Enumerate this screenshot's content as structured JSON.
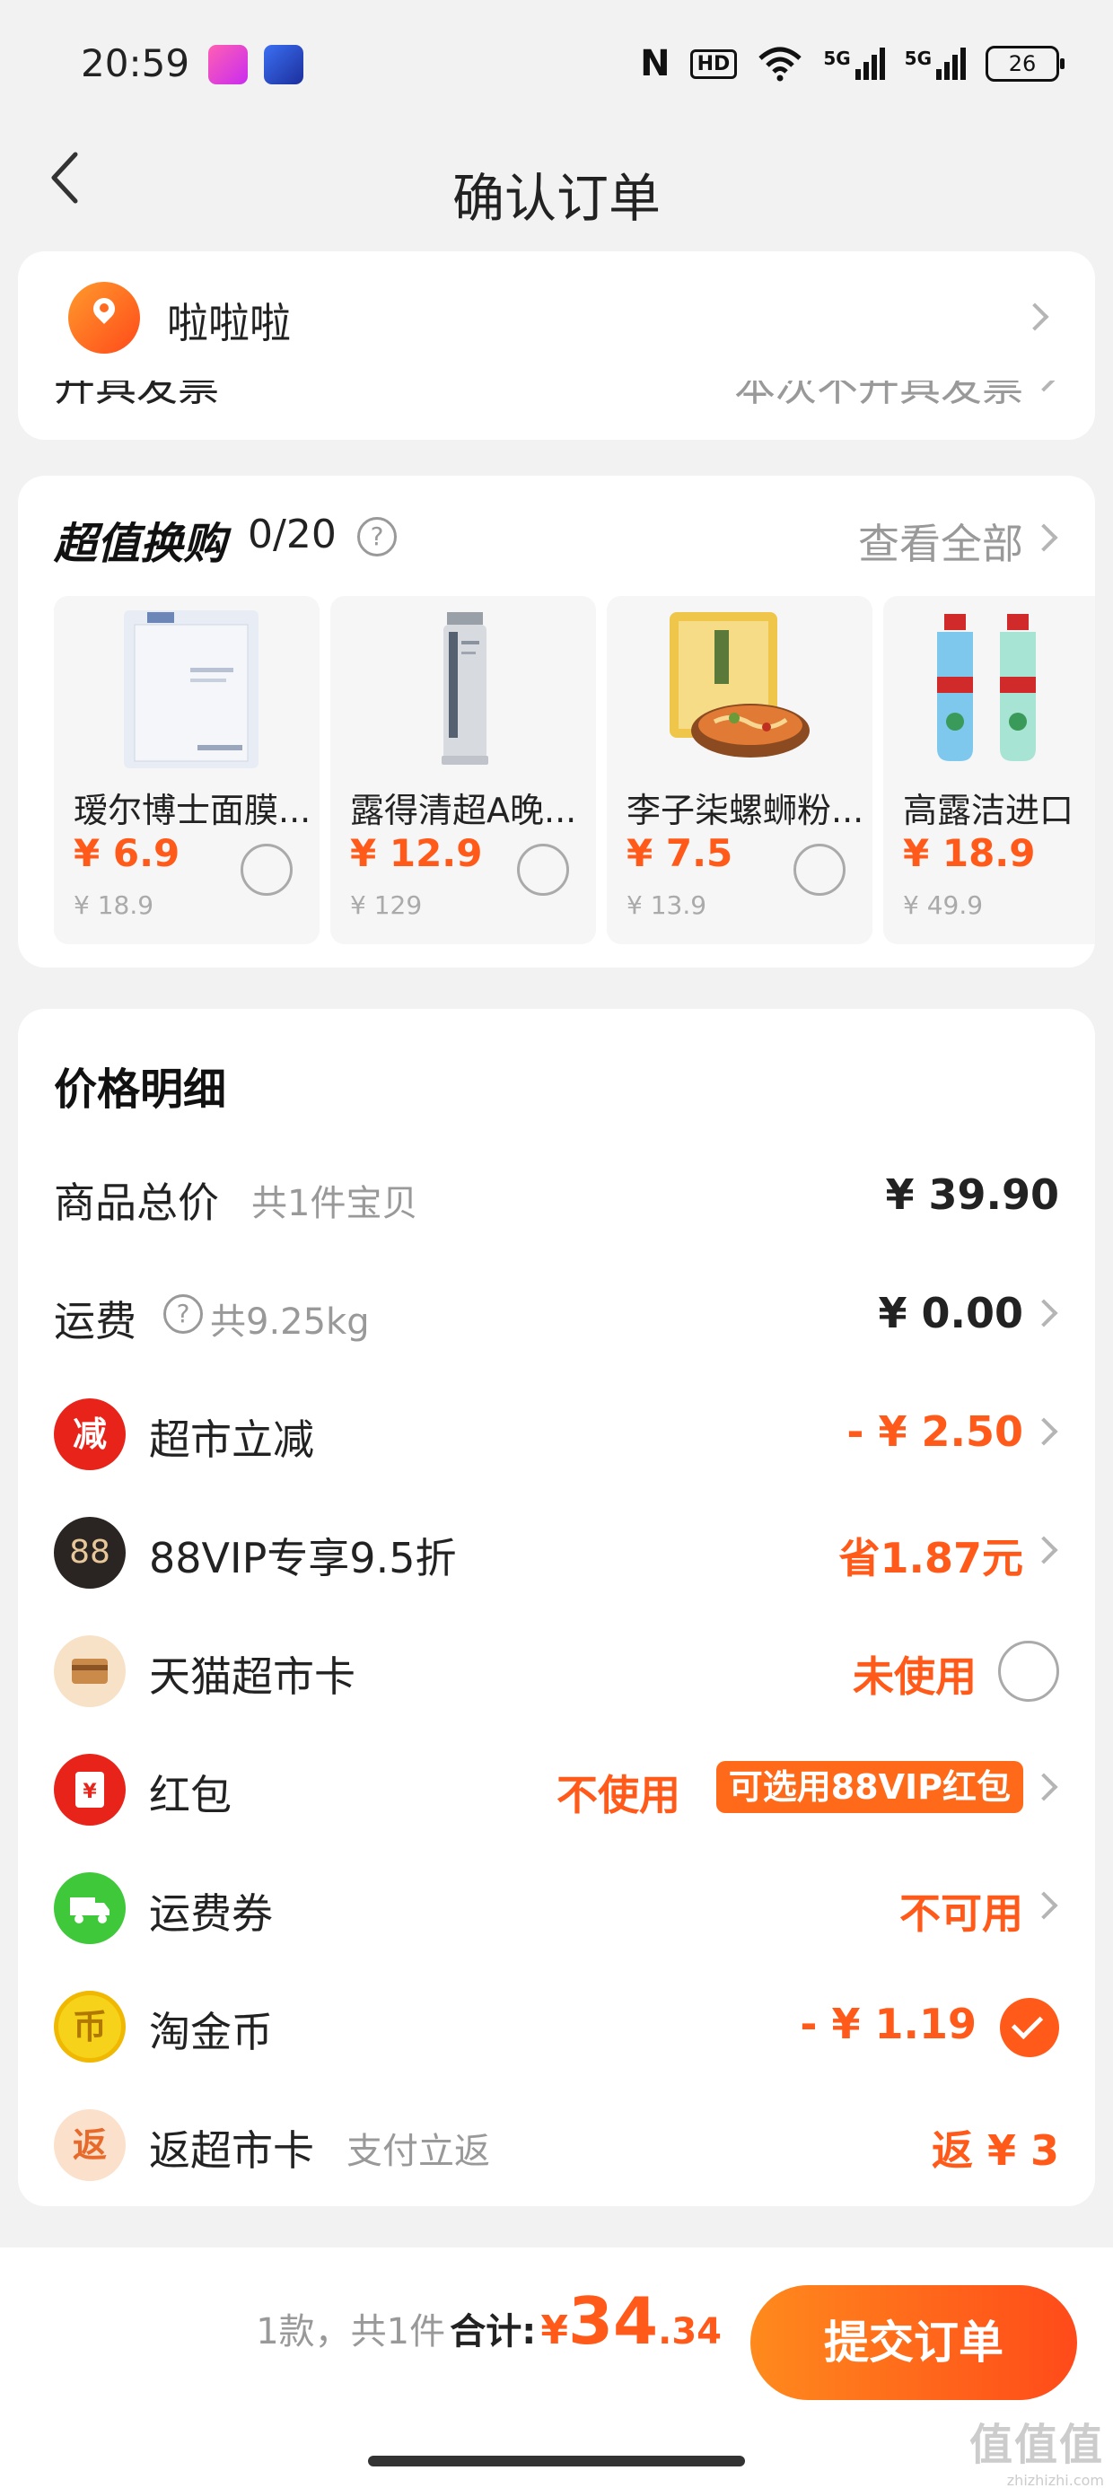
{
  "status_bar": {
    "time": "20:59",
    "nfc_icon": "N",
    "hd_label": "HD",
    "signal_1_label": "5G",
    "signal_2_label": "5G",
    "battery": "26"
  },
  "header": {
    "title": "确认订单"
  },
  "address": {
    "name": "啦啦啦"
  },
  "invoice": {
    "label": "开具发票",
    "value": "本次不开具发票"
  },
  "tradeup": {
    "title": "超值换购",
    "count": "0/20",
    "help": "?",
    "view_all": "查看全部",
    "products": [
      {
        "name": "瑷尔博士面膜...",
        "price": "¥ 6.9",
        "original": "¥ 18.9",
        "icon": "face-mask-product-icon"
      },
      {
        "name": "露得清超A晚...",
        "price": "¥ 12.9",
        "original": "¥ 129",
        "icon": "cream-tube-product-icon"
      },
      {
        "name": "李子柒螺蛳粉...",
        "price": "¥ 7.5",
        "original": "¥ 13.9",
        "icon": "noodle-pack-product-icon"
      },
      {
        "name": "高露洁进口",
        "price": "¥ 18.9",
        "original": "¥ 49.9",
        "icon": "mouthwash-product-icon"
      }
    ]
  },
  "price_detail": {
    "title": "价格明细",
    "rows": {
      "goods": {
        "label": "商品总价",
        "sub": "共1件宝贝",
        "value": "¥ 39.90"
      },
      "shipping": {
        "label": "运费",
        "help": "?",
        "sub": "共9.25kg",
        "value": "¥ 0.00"
      },
      "instant_discount": {
        "label": "超市立减",
        "icon_text": "减",
        "value": "- ¥ 2.50"
      },
      "vip": {
        "label": "88VIP专享9.5折",
        "icon_text": "88",
        "value": "省1.87元"
      },
      "tmall_card": {
        "label": "天猫超市卡",
        "value": "未使用"
      },
      "red_packet": {
        "label": "红包",
        "icon_text": "¥",
        "value": "不使用",
        "tag": "可选用88VIP红包"
      },
      "shipping_coupon": {
        "label": "运费券",
        "value": "不可用"
      },
      "gold_coin": {
        "label": "淘金币",
        "icon_text": "币",
        "value": "- ¥ 1.19"
      },
      "cashback": {
        "label": "返超市卡",
        "icon_text": "返",
        "sub": "支付立返",
        "value": "返 ¥ 3"
      }
    }
  },
  "bottom_bar": {
    "count": "1款，共1件",
    "total_label": "合计:",
    "currency": "¥",
    "total_int": "34",
    "total_dec": ".34",
    "submit": "提交订单"
  },
  "watermark": {
    "top": "值值值",
    "bottom": "zhizhizhi.com"
  },
  "colors": {
    "accent": "#ff5a1a",
    "background": "#f2f2f2"
  }
}
